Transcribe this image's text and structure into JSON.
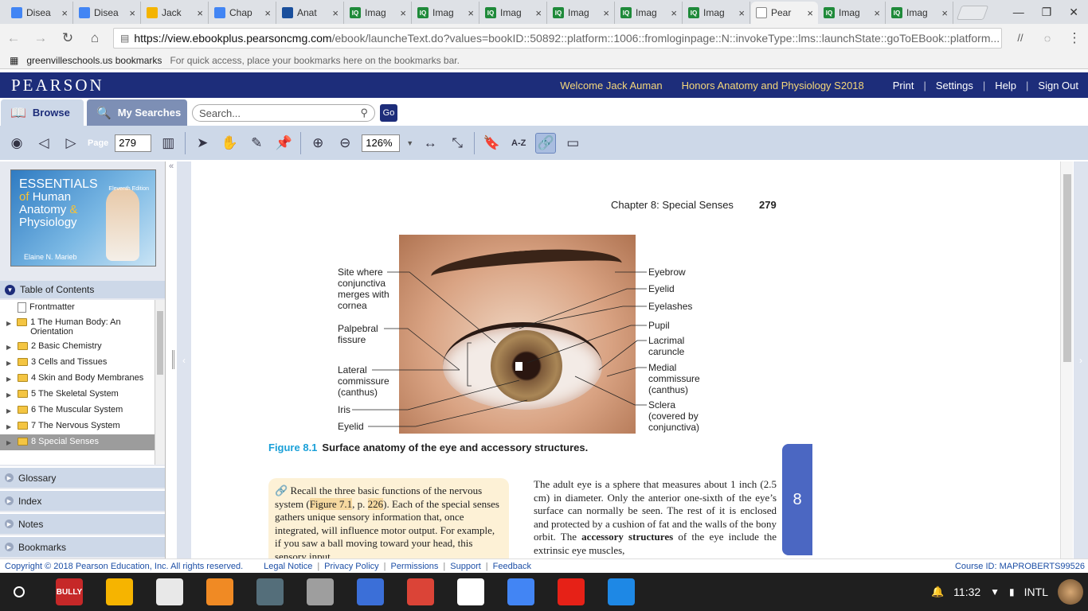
{
  "browser": {
    "tabs": [
      {
        "title": "Disea",
        "icon": "doc-icon",
        "kind": "doc",
        "active": false
      },
      {
        "title": "Disea",
        "icon": "doc-icon",
        "kind": "doc",
        "active": false
      },
      {
        "title": "Jack",
        "icon": "slides-icon",
        "kind": "slide",
        "active": false
      },
      {
        "title": "Chap",
        "icon": "doc-icon",
        "kind": "doc",
        "active": false
      },
      {
        "title": "Anat",
        "icon": "contact-icon",
        "kind": "contact",
        "active": false
      },
      {
        "title": "Imag",
        "icon": "iq-icon",
        "kind": "iq",
        "active": false
      },
      {
        "title": "Imag",
        "icon": "iq-icon",
        "kind": "iq",
        "active": false
      },
      {
        "title": "Imag",
        "icon": "iq-icon",
        "kind": "iq",
        "active": false
      },
      {
        "title": "Imag",
        "icon": "iq-icon",
        "kind": "iq",
        "active": false
      },
      {
        "title": "Imag",
        "icon": "iq-icon",
        "kind": "iq",
        "active": false
      },
      {
        "title": "Imag",
        "icon": "iq-icon",
        "kind": "iq",
        "active": false
      },
      {
        "title": "Pear",
        "icon": "page-icon",
        "kind": "page",
        "active": true
      },
      {
        "title": "Imag",
        "icon": "iq-icon",
        "kind": "iq",
        "active": false
      },
      {
        "title": "Imag",
        "icon": "iq-icon",
        "kind": "iq",
        "active": false
      }
    ],
    "url_host": "https://view.ebookplus.pearsoncmg.com",
    "url_rest": "/ebook/launcheText.do?values=bookID::50892::platform::1006::fromloginpage::N::invokeType::lms::launchState::goToEBook::platform...",
    "bookmarks_folder": "greenvilleschools.us bookmarks",
    "bookmarks_hint": "For quick access, place your bookmarks here on the bookmarks bar."
  },
  "header": {
    "logo": "PEARSON",
    "welcome": "Welcome Jack Auman",
    "course": "Honors Anatomy and Physiology S2018",
    "links": [
      "Print",
      "Settings",
      "Help",
      "Sign Out"
    ]
  },
  "search": {
    "browse_label": "Browse",
    "my_searches_label": "My Searches",
    "placeholder": "Search...",
    "go_label": "Go"
  },
  "reader_toolbar": {
    "page_label": "Page",
    "page_value": "279",
    "zoom_value": "126%"
  },
  "sidebar": {
    "cover": {
      "line1": "ESSENTIALS",
      "line2a": "of ",
      "line2b": "Human",
      "line3a": "Anatomy ",
      "line3b": "&",
      "line4": "Physiology",
      "edition": "Eleventh Edition",
      "author": "Elaine N. Marieb"
    },
    "toc_title": "Table of Contents",
    "toc_items": [
      {
        "label": "Frontmatter",
        "type": "page"
      },
      {
        "label": "1 The Human Body: An Orientation",
        "type": "folder"
      },
      {
        "label": "2 Basic Chemistry",
        "type": "folder"
      },
      {
        "label": "3 Cells and Tissues",
        "type": "folder"
      },
      {
        "label": "4 Skin and Body Membranes",
        "type": "folder"
      },
      {
        "label": "5 The Skeletal System",
        "type": "folder"
      },
      {
        "label": "6 The Muscular System",
        "type": "folder"
      },
      {
        "label": "7 The Nervous System",
        "type": "folder"
      },
      {
        "label": "8 Special Senses",
        "type": "folder",
        "selected": true
      }
    ],
    "sections": [
      "Glossary",
      "Index",
      "Notes",
      "Bookmarks"
    ]
  },
  "page": {
    "running_head": "Chapter 8: Special Senses",
    "page_number": "279",
    "figure_number": "Figure 8.1",
    "figure_caption": "Surface anatomy of the eye and accessory structures.",
    "left_labels": [
      "Site where conjunctiva merges with cornea",
      "Palpebral fissure",
      "Lateral commissure (canthus)",
      "Iris",
      "Eyelid"
    ],
    "right_labels": [
      "Eyebrow",
      "Eyelid",
      "Eyelashes",
      "Pupil",
      "Lacrimal caruncle",
      "Medial commissure (canthus)",
      "Sclera (covered by conjunctiva)"
    ],
    "recall_pre": "Recall the three basic functions of the nervous system (",
    "recall_link": "Figure 7.1",
    "recall_mid": ", p. ",
    "recall_page": "226",
    "recall_post": "). Each of the special senses gathers unique sensory information that, once integrated, will influence motor output. For example, if you saw a ball moving toward your head, this sensory input",
    "body_text_pre": "The adult eye is a sphere that measures about 1 inch (2.5 cm) in diameter. Only the anterior one-sixth of the eye’s surface can normally be seen. The rest of it is enclosed and protected by a cushion of fat and the walls of the bony orbit. The ",
    "body_text_bold": "accessory structures",
    "body_text_post": " of the eye include the extrinsic eye muscles,",
    "chapter_tab": "8"
  },
  "footer": {
    "copyright": "Copyright © 2018 Pearson Education, Inc. All rights reserved.",
    "links": [
      "Legal Notice",
      "Privacy Policy",
      "Permissions",
      "Support",
      "Feedback"
    ],
    "course_id": "Course ID: MAPROBERTS99526"
  },
  "taskbar": {
    "apps": [
      {
        "name": "bully-app-icon",
        "label": "BULLY",
        "color": "#c62828"
      },
      {
        "name": "keep-icon",
        "label": "",
        "color": "#f6b400"
      },
      {
        "name": "app-icon-2",
        "label": "",
        "color": "#e8e8e8"
      },
      {
        "name": "app-icon-3",
        "label": "",
        "color": "#f08a24"
      },
      {
        "name": "app-icon-4",
        "label": "",
        "color": "#546e7a"
      },
      {
        "name": "app-icon-5",
        "label": "",
        "color": "#9e9e9e"
      },
      {
        "name": "app-icon-6",
        "label": "",
        "color": "#3b6fd8"
      },
      {
        "name": "chrome-icon",
        "label": "",
        "color": "#db4437"
      },
      {
        "name": "gmail-icon",
        "label": "",
        "color": "#ffffff"
      },
      {
        "name": "docs-icon",
        "label": "",
        "color": "#4285f4"
      },
      {
        "name": "youtube-icon",
        "label": "",
        "color": "#e62117"
      },
      {
        "name": "canvas-icon",
        "label": "",
        "color": "#1e88e5"
      }
    ],
    "time": "11:32",
    "locale": "INTL"
  }
}
